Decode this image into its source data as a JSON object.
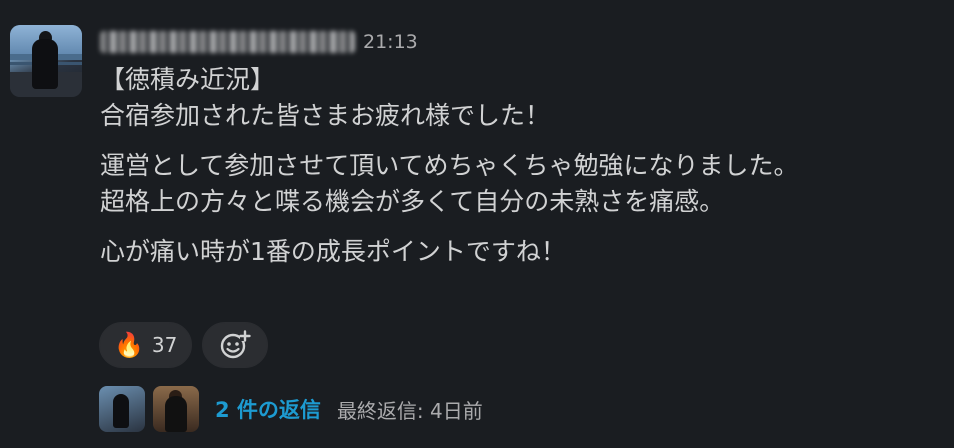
{
  "message": {
    "time": "21:13",
    "lines": [
      "【徳積み近況】",
      "合宿参加された皆さまお疲れ様でした！",
      "運営として参加させて頂いてめちゃくちゃ勉強になりました。",
      "超格上の方々と喋る機会が多くて自分の未熟さを痛感。",
      "心が痛い時が1番の成長ポイントですね！"
    ]
  },
  "reactions": [
    {
      "emoji": "🔥",
      "count": "37"
    }
  ],
  "add_reaction_icon": "add-emoji-icon",
  "thread": {
    "reply_count": "2 件の返信",
    "last_reply": "最終返信: 4日前"
  },
  "colors": {
    "background": "#1a1d21",
    "text": "#d1d2d3",
    "link": "#1d9bd1",
    "muted": "#ababad"
  }
}
